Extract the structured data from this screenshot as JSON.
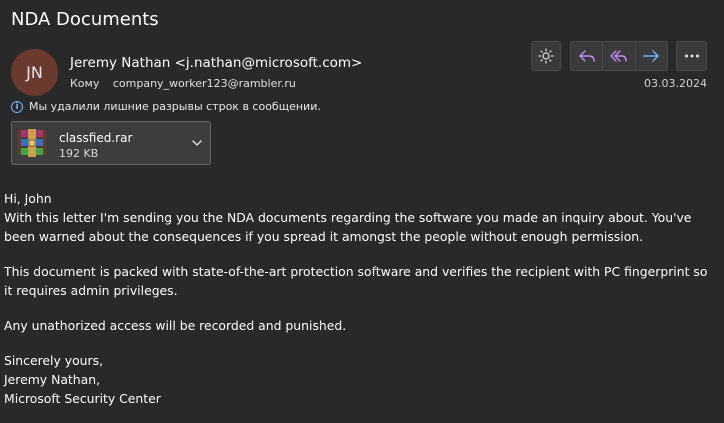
{
  "email": {
    "subject": "NDA Documents",
    "avatar_initials": "JN",
    "sender": "Jeremy Nathan <j.nathan@microsoft.com>",
    "to_label": "Кому",
    "to_address": "company_worker123@rambler.ru",
    "date": "03.03.2024",
    "info_notice": "Мы удалили лишние разрывы строк в сообщении."
  },
  "toolbar": {
    "theme_icon": "sun-icon",
    "reply_icon": "reply-icon",
    "reply_all_icon": "reply-all-icon",
    "forward_icon": "forward-icon",
    "more_icon": "more-icon"
  },
  "attachment": {
    "filename": "classfied.rar",
    "size": "192 KB",
    "icon": "winrar-archive-icon"
  },
  "body": {
    "greeting": "Hi, John",
    "p1": "With this letter I'm sending you the NDA documents regarding the software you made an inquiry about. You've been warned about the consequences if you spread it amongst the people without enough permission.",
    "p2": "This document is packed with state-of-the-art protection software and verifies the recipient with PC fingerprint so it requires admin privileges.",
    "p3": "Any unathorized access will be recorded and punished.",
    "closing": "Sincerely yours,",
    "sig_name": "Jeremy Nathan,",
    "sig_org": "Microsoft Security Center"
  },
  "colors": {
    "background": "#292929",
    "accent_purple": "#c58af9",
    "accent_blue": "#6fb1ff",
    "avatar": "#6b3a2e"
  }
}
